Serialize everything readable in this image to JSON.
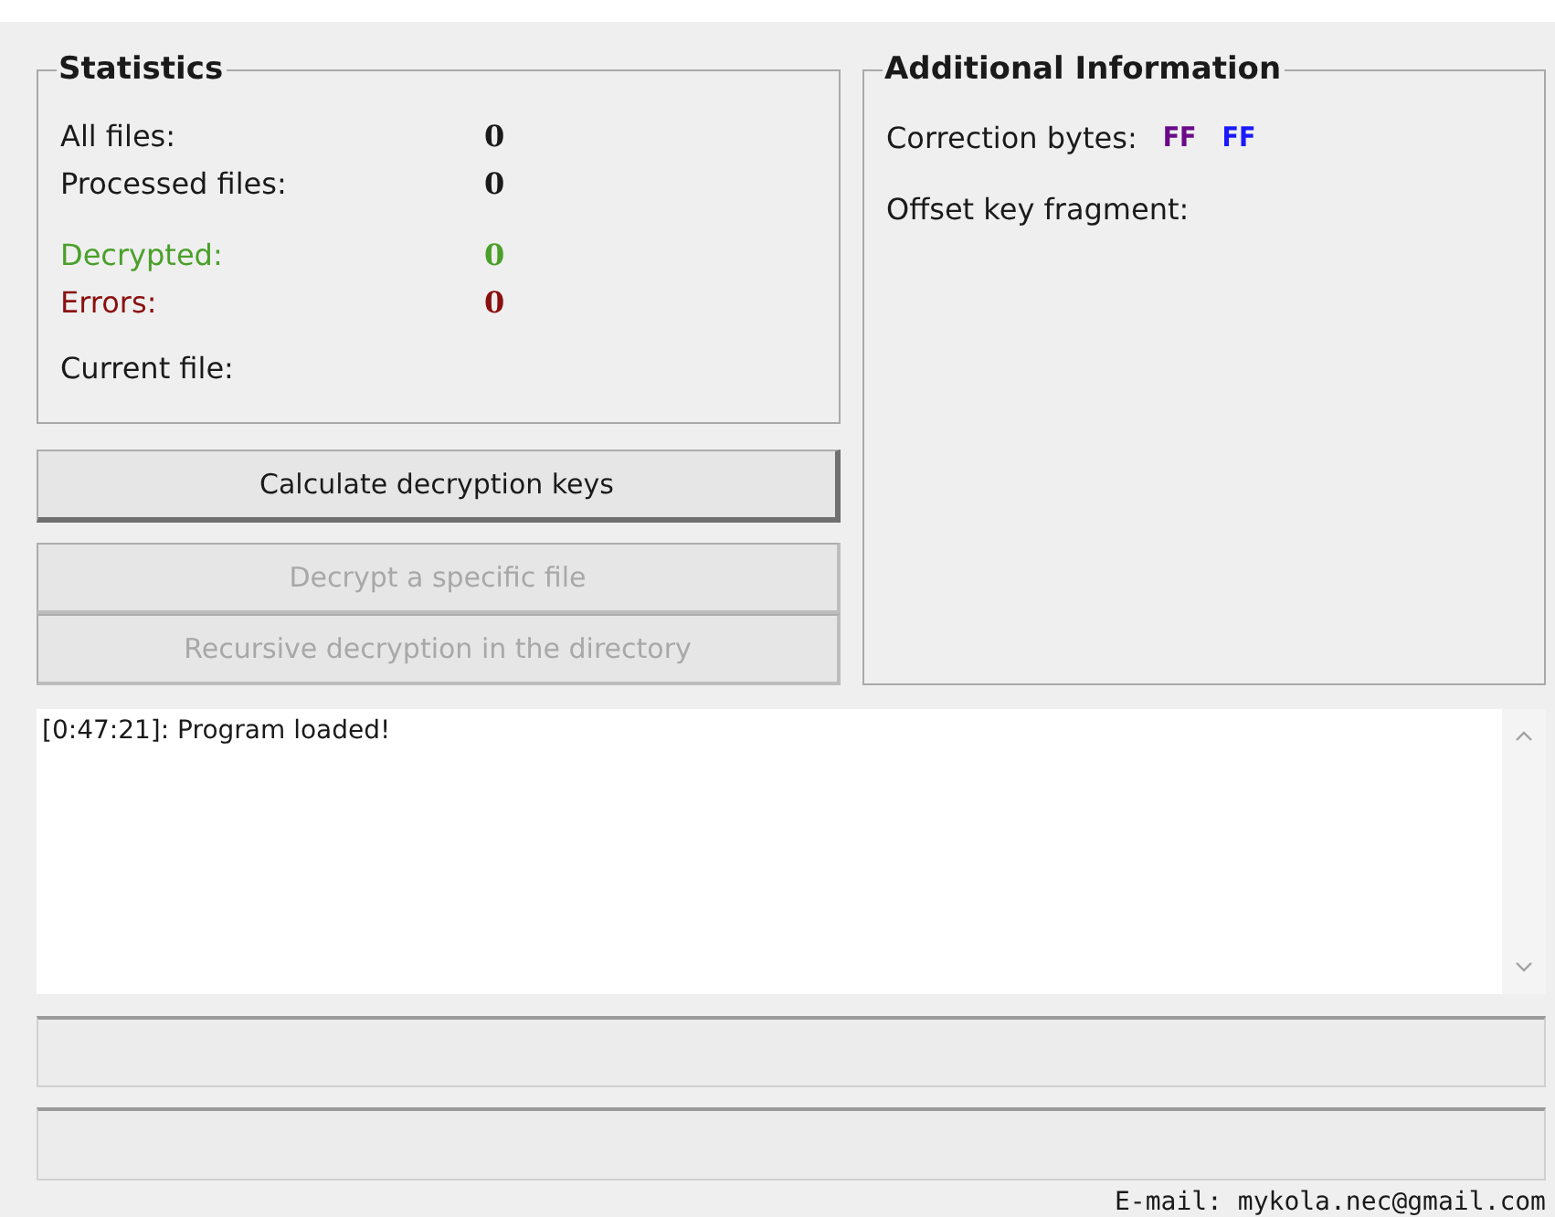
{
  "statistics": {
    "title": "Statistics",
    "rows": [
      {
        "label": "All files:",
        "value": "0",
        "kind": "plain"
      },
      {
        "label": "Processed files:",
        "value": "0",
        "kind": "plain"
      },
      {
        "label": "Decrypted:",
        "value": "0",
        "kind": "success"
      },
      {
        "label": "Errors:",
        "value": "0",
        "kind": "error"
      }
    ],
    "current_file_label": "Current file:"
  },
  "additional_information": {
    "title": "Additional Information",
    "correction_bytes_label": "Correction bytes:",
    "correction_bytes": [
      {
        "text": "FF",
        "color": "#6a0a8a"
      },
      {
        "text": "FF",
        "color": "#1a1aff"
      }
    ],
    "offset_key_fragment_label": "Offset key fragment:"
  },
  "buttons": [
    {
      "label": "Calculate decryption keys",
      "disabled": false
    },
    {
      "label": "Decrypt a specific file",
      "disabled": true
    },
    {
      "label": "Recursive decryption in the directory",
      "disabled": true
    }
  ],
  "log": [
    "[0:47:21]: Program loaded!"
  ],
  "progress_bars": [
    {
      "level": 0
    },
    {
      "level": 0
    }
  ],
  "footer": "E-mail: mykola.nec@gmail.com"
}
